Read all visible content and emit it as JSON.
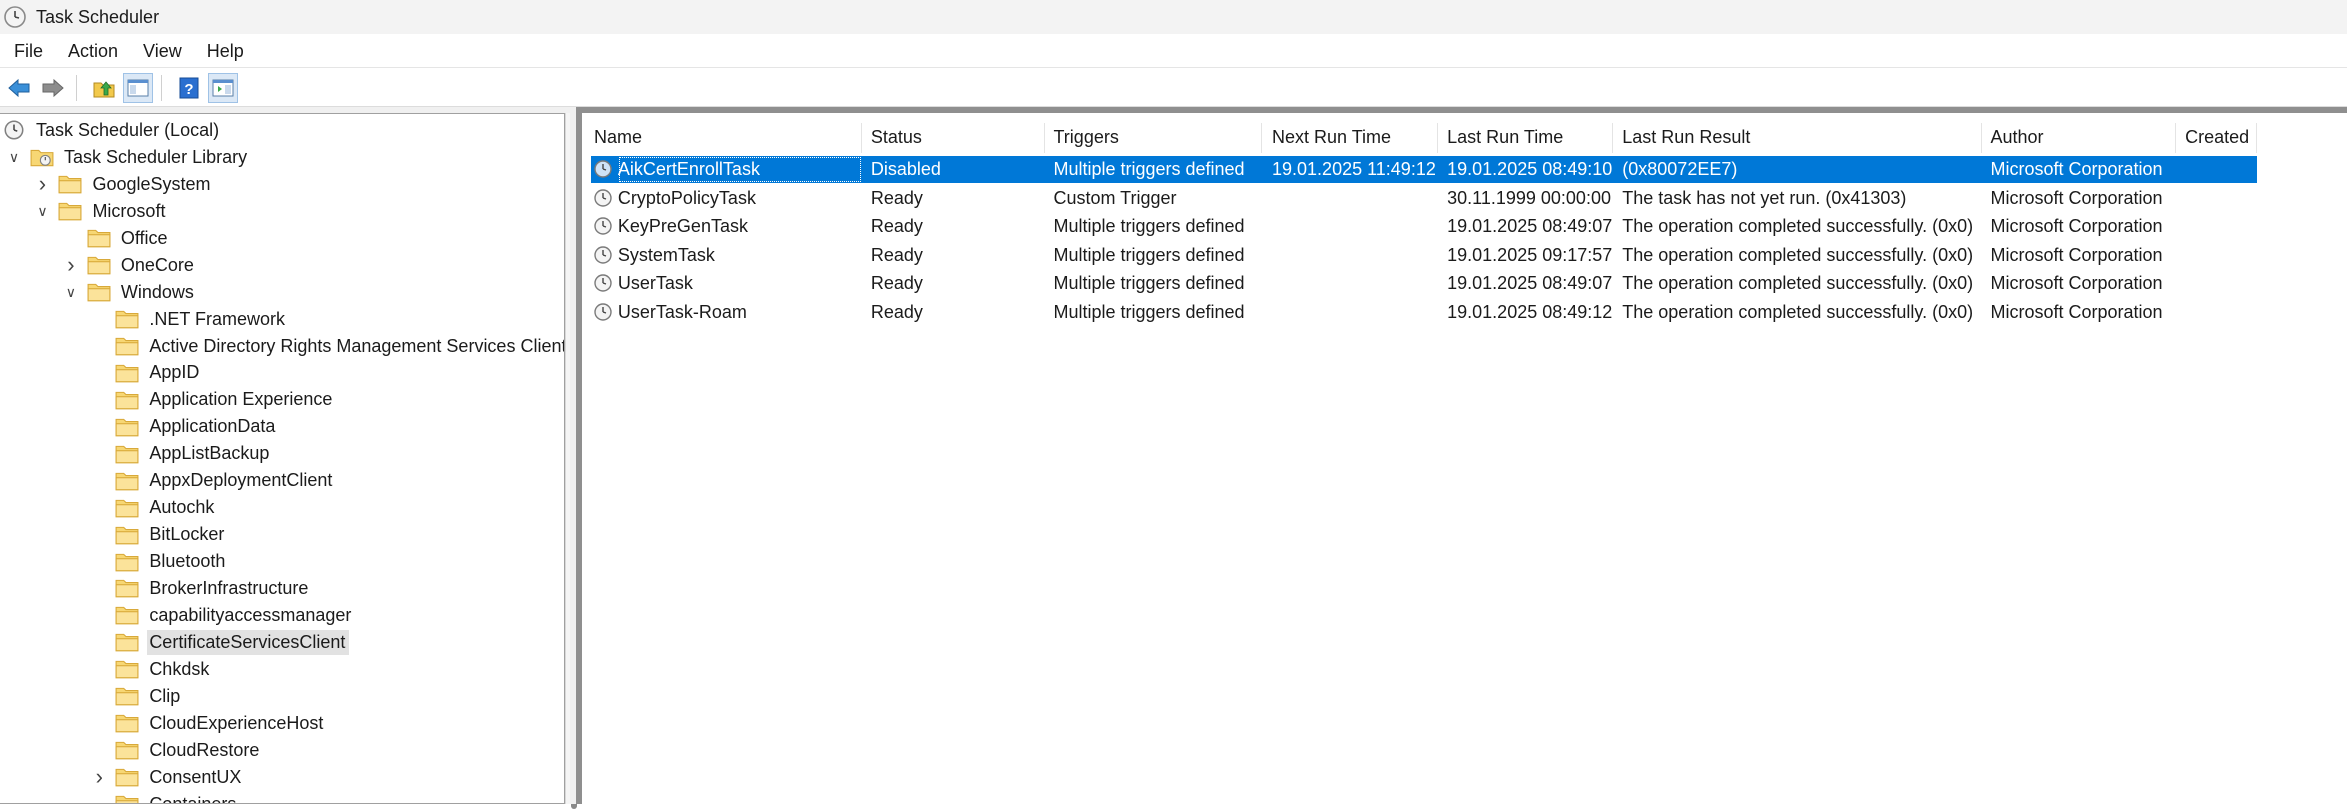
{
  "window": {
    "title": "Task Scheduler"
  },
  "menu": [
    "File",
    "Action",
    "View",
    "Help"
  ],
  "toolbar": {
    "icons": [
      "back-arrow-icon",
      "forward-arrow-icon",
      "up-folder-icon",
      "show-hide-console-tree-icon",
      "help-icon",
      "show-hide-action-pane-icon"
    ]
  },
  "tree": {
    "root": "Task Scheduler (Local)",
    "library": "Task Scheduler Library",
    "items": [
      {
        "label": "GoogleSystem",
        "level": 2,
        "expander": "collapsed"
      },
      {
        "label": "Microsoft",
        "level": 2,
        "expander": "expanded"
      },
      {
        "label": "Office",
        "level": 3,
        "expander": "none"
      },
      {
        "label": "OneCore",
        "level": 3,
        "expander": "collapsed"
      },
      {
        "label": "Windows",
        "level": 3,
        "expander": "expanded"
      },
      {
        "label": ".NET Framework",
        "level": 4,
        "expander": "none"
      },
      {
        "label": "Active Directory Rights Management Services Client",
        "level": 4,
        "expander": "none"
      },
      {
        "label": "AppID",
        "level": 4,
        "expander": "none"
      },
      {
        "label": "Application Experience",
        "level": 4,
        "expander": "none"
      },
      {
        "label": "ApplicationData",
        "level": 4,
        "expander": "none"
      },
      {
        "label": "AppListBackup",
        "level": 4,
        "expander": "none"
      },
      {
        "label": "AppxDeploymentClient",
        "level": 4,
        "expander": "none"
      },
      {
        "label": "Autochk",
        "level": 4,
        "expander": "none"
      },
      {
        "label": "BitLocker",
        "level": 4,
        "expander": "none"
      },
      {
        "label": "Bluetooth",
        "level": 4,
        "expander": "none"
      },
      {
        "label": "BrokerInfrastructure",
        "level": 4,
        "expander": "none"
      },
      {
        "label": "capabilityaccessmanager",
        "level": 4,
        "expander": "none"
      },
      {
        "label": "CertificateServicesClient",
        "level": 4,
        "expander": "none",
        "selected": true
      },
      {
        "label": "Chkdsk",
        "level": 4,
        "expander": "none"
      },
      {
        "label": "Clip",
        "level": 4,
        "expander": "none"
      },
      {
        "label": "CloudExperienceHost",
        "level": 4,
        "expander": "none"
      },
      {
        "label": "CloudRestore",
        "level": 4,
        "expander": "none"
      },
      {
        "label": "ConsentUX",
        "level": 4,
        "expander": "collapsed"
      },
      {
        "label": "Containers",
        "level": 4,
        "expander": "none"
      }
    ]
  },
  "table": {
    "columns": [
      "Name",
      "Status",
      "Triggers",
      "Next Run Time",
      "Last Run Time",
      "Last Run Result",
      "Author",
      "Created"
    ],
    "rows": [
      {
        "name": "AikCertEnrollTask",
        "status": "Disabled",
        "triggers": "Multiple triggers defined",
        "next_run": "19.01.2025 11:49:12",
        "last_run": "19.01.2025 08:49:10",
        "result": "(0x80072EE7)",
        "author": "Microsoft Corporation",
        "created": "",
        "selected": true
      },
      {
        "name": "CryptoPolicyTask",
        "status": "Ready",
        "triggers": "Custom Trigger",
        "next_run": "",
        "last_run": "30.11.1999 00:00:00",
        "result": "The task has not yet run. (0x41303)",
        "author": "Microsoft Corporation",
        "created": ""
      },
      {
        "name": "KeyPreGenTask",
        "status": "Ready",
        "triggers": "Multiple triggers defined",
        "next_run": "",
        "last_run": "19.01.2025 08:49:07",
        "result": "The operation completed successfully. (0x0)",
        "author": "Microsoft Corporation",
        "created": ""
      },
      {
        "name": "SystemTask",
        "status": "Ready",
        "triggers": "Multiple triggers defined",
        "next_run": "",
        "last_run": "19.01.2025 09:17:57",
        "result": "The operation completed successfully. (0x0)",
        "author": "Microsoft Corporation",
        "created": ""
      },
      {
        "name": "UserTask",
        "status": "Ready",
        "triggers": "Multiple triggers defined",
        "next_run": "",
        "last_run": "19.01.2025 08:49:07",
        "result": "The operation completed successfully. (0x0)",
        "author": "Microsoft Corporation",
        "created": ""
      },
      {
        "name": "UserTask-Roam",
        "status": "Ready",
        "triggers": "Multiple triggers defined",
        "next_run": "",
        "last_run": "19.01.2025 08:49:12",
        "result": "The operation completed successfully. (0x0)",
        "author": "Microsoft Corporation",
        "created": ""
      }
    ]
  },
  "colors": {
    "selection": "#0078d7",
    "folder": "#f7d774",
    "folder_edge": "#d8a93a",
    "tree_selection": "#e2e2e2"
  }
}
